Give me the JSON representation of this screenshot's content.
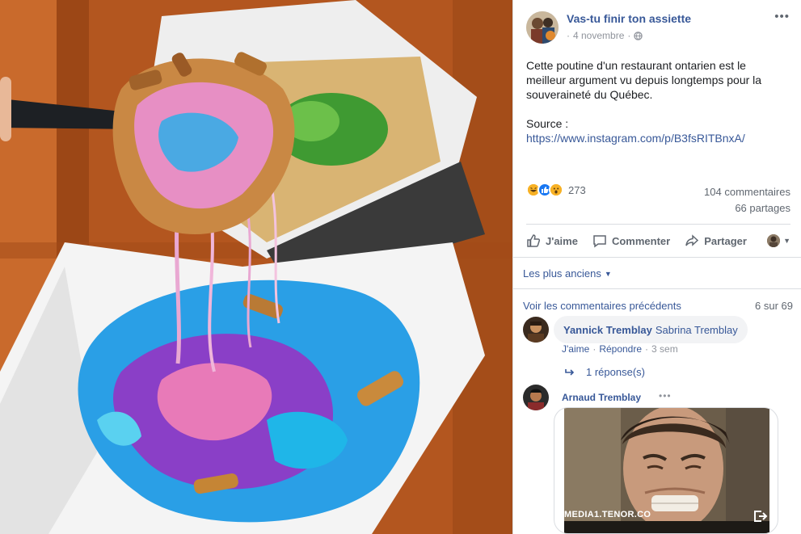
{
  "post": {
    "page_name": "Vas-tu finir ton assiette",
    "date": "4 novembre",
    "text": "Cette poutine d'un restaurant ontarien est le meilleur argument vu depuis longtemps pour la souveraineté du Québec.",
    "source_label": "Source : ",
    "source_link": "https://www.instagram.com/p/B3fsRITBnxA/",
    "icons": [
      "more-icon",
      "globe-icon"
    ]
  },
  "stats": {
    "reactions_count": "273",
    "reaction_types": [
      "haha",
      "like",
      "wow"
    ],
    "comments": "104 commentaires",
    "shares": "66 partages"
  },
  "actions": {
    "like": "J'aime",
    "comment": "Commenter",
    "share": "Partager"
  },
  "comments_section": {
    "sort_label": "Les plus anciens",
    "view_previous": "Voir les commentaires précédents",
    "pager": "6 sur 69",
    "comment1": {
      "author": "Yannick Tremblay",
      "mention": "Sabrina Tremblay",
      "like": "J'aime",
      "sep1": "·",
      "reply": "Répondre",
      "sep2": "·",
      "time": "3 sem",
      "replies": "1 réponse(s)"
    },
    "comment2": {
      "author": "Arnaud Tremblay",
      "gif_caption": "MEDIA1.TENOR.CO"
    }
  },
  "colors": {
    "link": "#385898",
    "muted": "#606770",
    "like_blue": "#1877f2",
    "haha_yellow": "#f7b125"
  }
}
